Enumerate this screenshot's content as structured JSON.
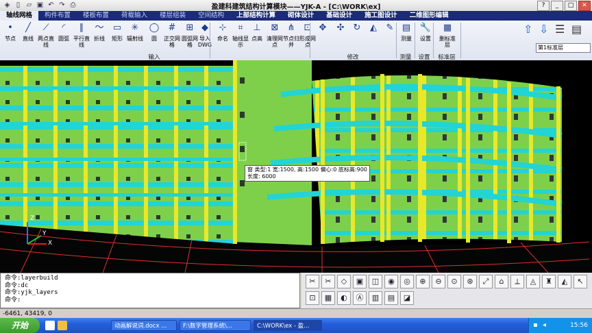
{
  "window": {
    "title": "盈建科建筑结构计算模块——YJK-A - [C:\\WORK\\ex]"
  },
  "quick_icons": [
    "app-icon",
    "new-icon",
    "open-icon",
    "save-icon",
    "undo-icon",
    "redo-icon",
    "print-icon"
  ],
  "menu_tabs": [
    {
      "label": "轴线网格",
      "active": true
    },
    {
      "label": "构件布置"
    },
    {
      "label": "楼板布置"
    },
    {
      "label": "荷载输入"
    },
    {
      "label": "楼层组装"
    },
    {
      "label": "空间结构"
    },
    {
      "label": "上部结构计算",
      "hi": true
    },
    {
      "label": "砌体设计",
      "hi": true
    },
    {
      "label": "基础设计",
      "hi": true
    },
    {
      "label": "施工图设计",
      "hi": true
    },
    {
      "label": "二维图形编辑",
      "hi": true
    }
  ],
  "ribbon": {
    "tools": [
      {
        "label": "节点",
        "icon": "•"
      },
      {
        "label": "直线",
        "icon": "╱"
      },
      {
        "label": "两点直线",
        "icon": "⟋"
      },
      {
        "label": "圆弧",
        "icon": "◜"
      },
      {
        "label": "平行直线",
        "icon": "∥"
      },
      {
        "label": "折线",
        "icon": "〜"
      },
      {
        "label": "矩形",
        "icon": "▭"
      },
      {
        "label": "辐射线",
        "icon": "✳"
      },
      {
        "label": "圆",
        "icon": "◯"
      },
      {
        "label": "正交网格",
        "icon": "#"
      },
      {
        "label": "圆弧网格",
        "icon": "⊞"
      },
      {
        "label": "导入DWG",
        "icon": "◆"
      },
      {
        "label": "命名",
        "icon": "⊹"
      },
      {
        "label": "轴线显示",
        "icon": "⌗"
      },
      {
        "label": "点高",
        "icon": "⊥"
      },
      {
        "label": "清理网点",
        "icon": "⊠"
      },
      {
        "label": "节点归并",
        "icon": "⋔"
      },
      {
        "label": "形成网点",
        "icon": "⊡"
      },
      {
        "label": "",
        "icon": "✥"
      },
      {
        "label": "",
        "icon": "✣"
      },
      {
        "label": "",
        "icon": "↻"
      },
      {
        "label": "",
        "icon": "◭"
      },
      {
        "label": "",
        "icon": "✎"
      },
      {
        "label": "测量",
        "icon": "▤"
      },
      {
        "label": "设置",
        "icon": "🔧"
      },
      {
        "label": "删标准层",
        "icon": "▦"
      }
    ],
    "groups": [
      {
        "label": "输入"
      },
      {
        "label": "修改"
      },
      {
        "label": "测量"
      },
      {
        "label": "设置"
      },
      {
        "label": "标准层"
      }
    ],
    "floor_select": "第1标准层"
  },
  "viewport": {
    "tooltip": {
      "line1": "窗 类型:1 宽:1500, 高:1500 偏心:0 底标高:900",
      "line2": "长度: 6000"
    },
    "axes": {
      "x": "X",
      "y": "Y",
      "z": "Z"
    }
  },
  "command": {
    "lines": [
      "命令:layerbuild",
      "命令:dc",
      "命令:yjk_layers",
      "命令:"
    ]
  },
  "status": {
    "coords": "-6461, 43419, 0"
  },
  "taskbar": {
    "start": "开始",
    "tasks": [
      {
        "label": "动画解说词.docx ..."
      },
      {
        "label": "F:\\数字管理系统\\..."
      },
      {
        "label": "C:\\WORK\\ex - 盈...",
        "active": true
      }
    ],
    "clock": "15:56"
  }
}
